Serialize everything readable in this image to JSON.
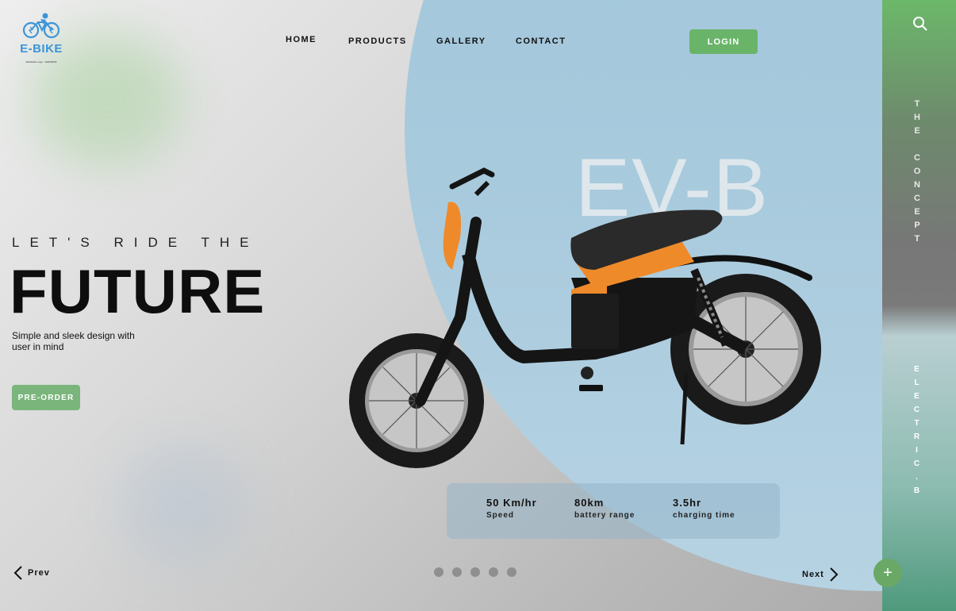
{
  "brand": {
    "name": "E-BIKE",
    "tagline": "Rankbabu Logo · 2025/09/04",
    "color": "#3b95d8"
  },
  "nav": {
    "items": [
      "HOME",
      "PRODUCTS",
      "GALLERY",
      "CONTACT"
    ],
    "login_label": "LOGIN"
  },
  "icons": {
    "search": "search-icon",
    "prev": "chevron-left-icon",
    "next": "chevron-right-icon",
    "add": "plus-icon"
  },
  "hero": {
    "pretitle": "LET'S RIDE THE",
    "title": "FUTURE",
    "description": "Simple and sleek design with user in mind",
    "cta_label": "PRE-ORDER",
    "model_watermark": "EV-B"
  },
  "side": {
    "top_label": "THE CONCEPT",
    "bottom_label": "ELECTRIC.B"
  },
  "stats": [
    {
      "value": "50 Km/hr",
      "label": "Speed"
    },
    {
      "value": "80km",
      "label": "battery range"
    },
    {
      "value": "3.5hr",
      "label": "charging time"
    }
  ],
  "carousel": {
    "prev_label": "Prev",
    "next_label": "Next",
    "slide_count": 5,
    "plus_label": "+"
  },
  "colors": {
    "accent_green": "#6ab46a",
    "sky_blue": "#a8cadd",
    "bike_orange": "#ef8a2a"
  }
}
